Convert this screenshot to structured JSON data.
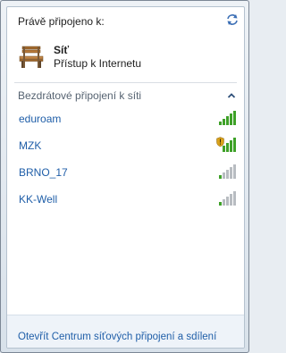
{
  "header": {
    "title": "Právě připojeno k:"
  },
  "current_network": {
    "name": "Síť",
    "status": "Přístup k Internetu"
  },
  "wireless_section": {
    "title": "Bezdrátové připojení k síti",
    "networks": [
      {
        "name": "eduroam",
        "signal_bars": 5,
        "secured_warning": false
      },
      {
        "name": "MZK",
        "signal_bars": 5,
        "secured_warning": true
      },
      {
        "name": "BRNO_17",
        "signal_bars": 1,
        "secured_warning": false
      },
      {
        "name": "KK-Well",
        "signal_bars": 1,
        "secured_warning": false
      }
    ]
  },
  "footer": {
    "link_label": "Otevřít Centrum síťových připojení a sdílení"
  },
  "colors": {
    "link_blue": "#1f5ea8",
    "signal_green": "#3ea128",
    "signal_gray": "#b8bcc1",
    "shield_gold": "#d9a21b"
  },
  "icons": [
    "refresh-icon",
    "bench-icon",
    "chevron-up-icon",
    "signal-icon",
    "shield-warning-icon"
  ]
}
